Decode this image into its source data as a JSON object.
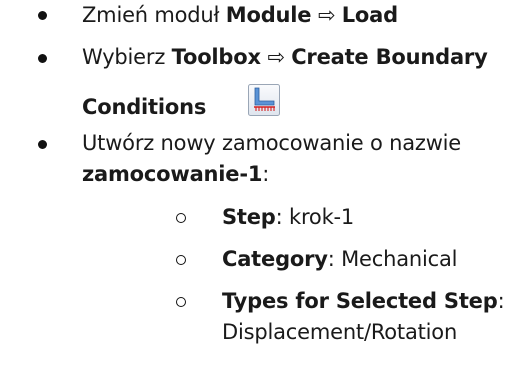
{
  "items": [
    {
      "text": "Zmień moduł ",
      "bold1": "Module",
      "arrow": " ⇨ ",
      "bold2": "Load"
    },
    {
      "text": "Wybierz ",
      "bold1": "Toolbox",
      "arrow": " ⇨ ",
      "bold2": "Create Boundary",
      "bold2_cont": "Conditions",
      "icon": "create-boundary-conditions-icon"
    },
    {
      "text": "Utwórz nowy zamocowanie o nazwie",
      "bold_name": "zamocowanie-1",
      "colon": ":",
      "sub_items": [
        {
          "label": "Step",
          "sep": ": ",
          "value": "krok-1"
        },
        {
          "label": "Category",
          "sep": ": ",
          "value": "Mechanical"
        },
        {
          "label": "Types for Selected Step",
          "sep": ":",
          "value": "Displacement/Rotation"
        }
      ]
    }
  ]
}
